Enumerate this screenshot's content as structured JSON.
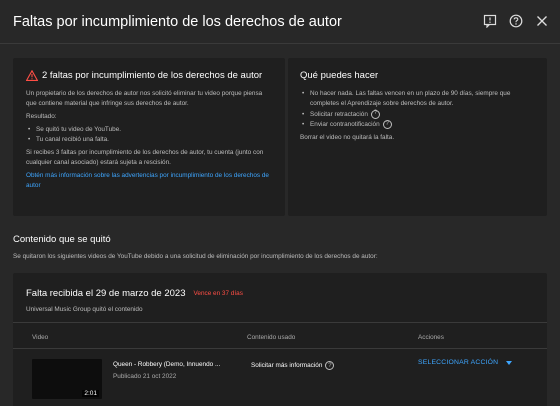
{
  "header": {
    "title": "Faltas por incumplimiento de los derechos de autor",
    "icons": [
      "feedback-icon",
      "help-icon",
      "close-icon"
    ]
  },
  "left_card": {
    "title": "2 faltas por incumplimiento de los derechos de autor",
    "intro": "Un propietario de los derechos de autor nos solicitó eliminar tu video porque piensa que contiene material que infringe sus derechos de autor.",
    "result_label": "Resultado:",
    "results": [
      "Se quitó tu video de YouTube.",
      "Tu canal recibió una falta."
    ],
    "warning": "Si recibes 3 faltas por incumplimiento de los derechos de autor, tu cuenta (junto con cualquier canal asociado) estará sujeta a rescisión.",
    "link": "Obtén más información sobre las advertencias por incumplimiento de los derechos de autor"
  },
  "right_card": {
    "title": "Qué puedes hacer",
    "options": [
      "No hacer nada. Las faltas vencen en un plazo de 90 días, siempre que completes el Aprendizaje sobre derechos de autor.",
      "Solicitar retractación",
      "Enviar contranotificación"
    ],
    "footer": "Borrar el video no quitará la falta."
  },
  "removed_section": {
    "title": "Contenido que se quitó",
    "description": "Se quitaron los siguientes videos de YouTube debido a una solicitud de eliminación por incumplimiento de los derechos de autor:"
  },
  "strike": {
    "title": "Falta recibida el 29 de marzo de 2023",
    "badge": "Vence en 37 días",
    "owner": "Universal Music Group quitó el contenido",
    "columns": {
      "video": "Video",
      "content_used": "Contenido usado",
      "actions": "Acciones"
    },
    "row": {
      "video_title": "Queen - Robbery (Demo, Innuendo ...",
      "published": "Publicado 21 oct 2022",
      "duration": "2:01",
      "content_used": "Solicitar más información",
      "action": "SELECCIONAR ACCIÓN"
    }
  },
  "colors": {
    "background": "#282828",
    "card": "#1f1f1f",
    "link": "#3ea6ff",
    "warning": "#ff4e45"
  }
}
